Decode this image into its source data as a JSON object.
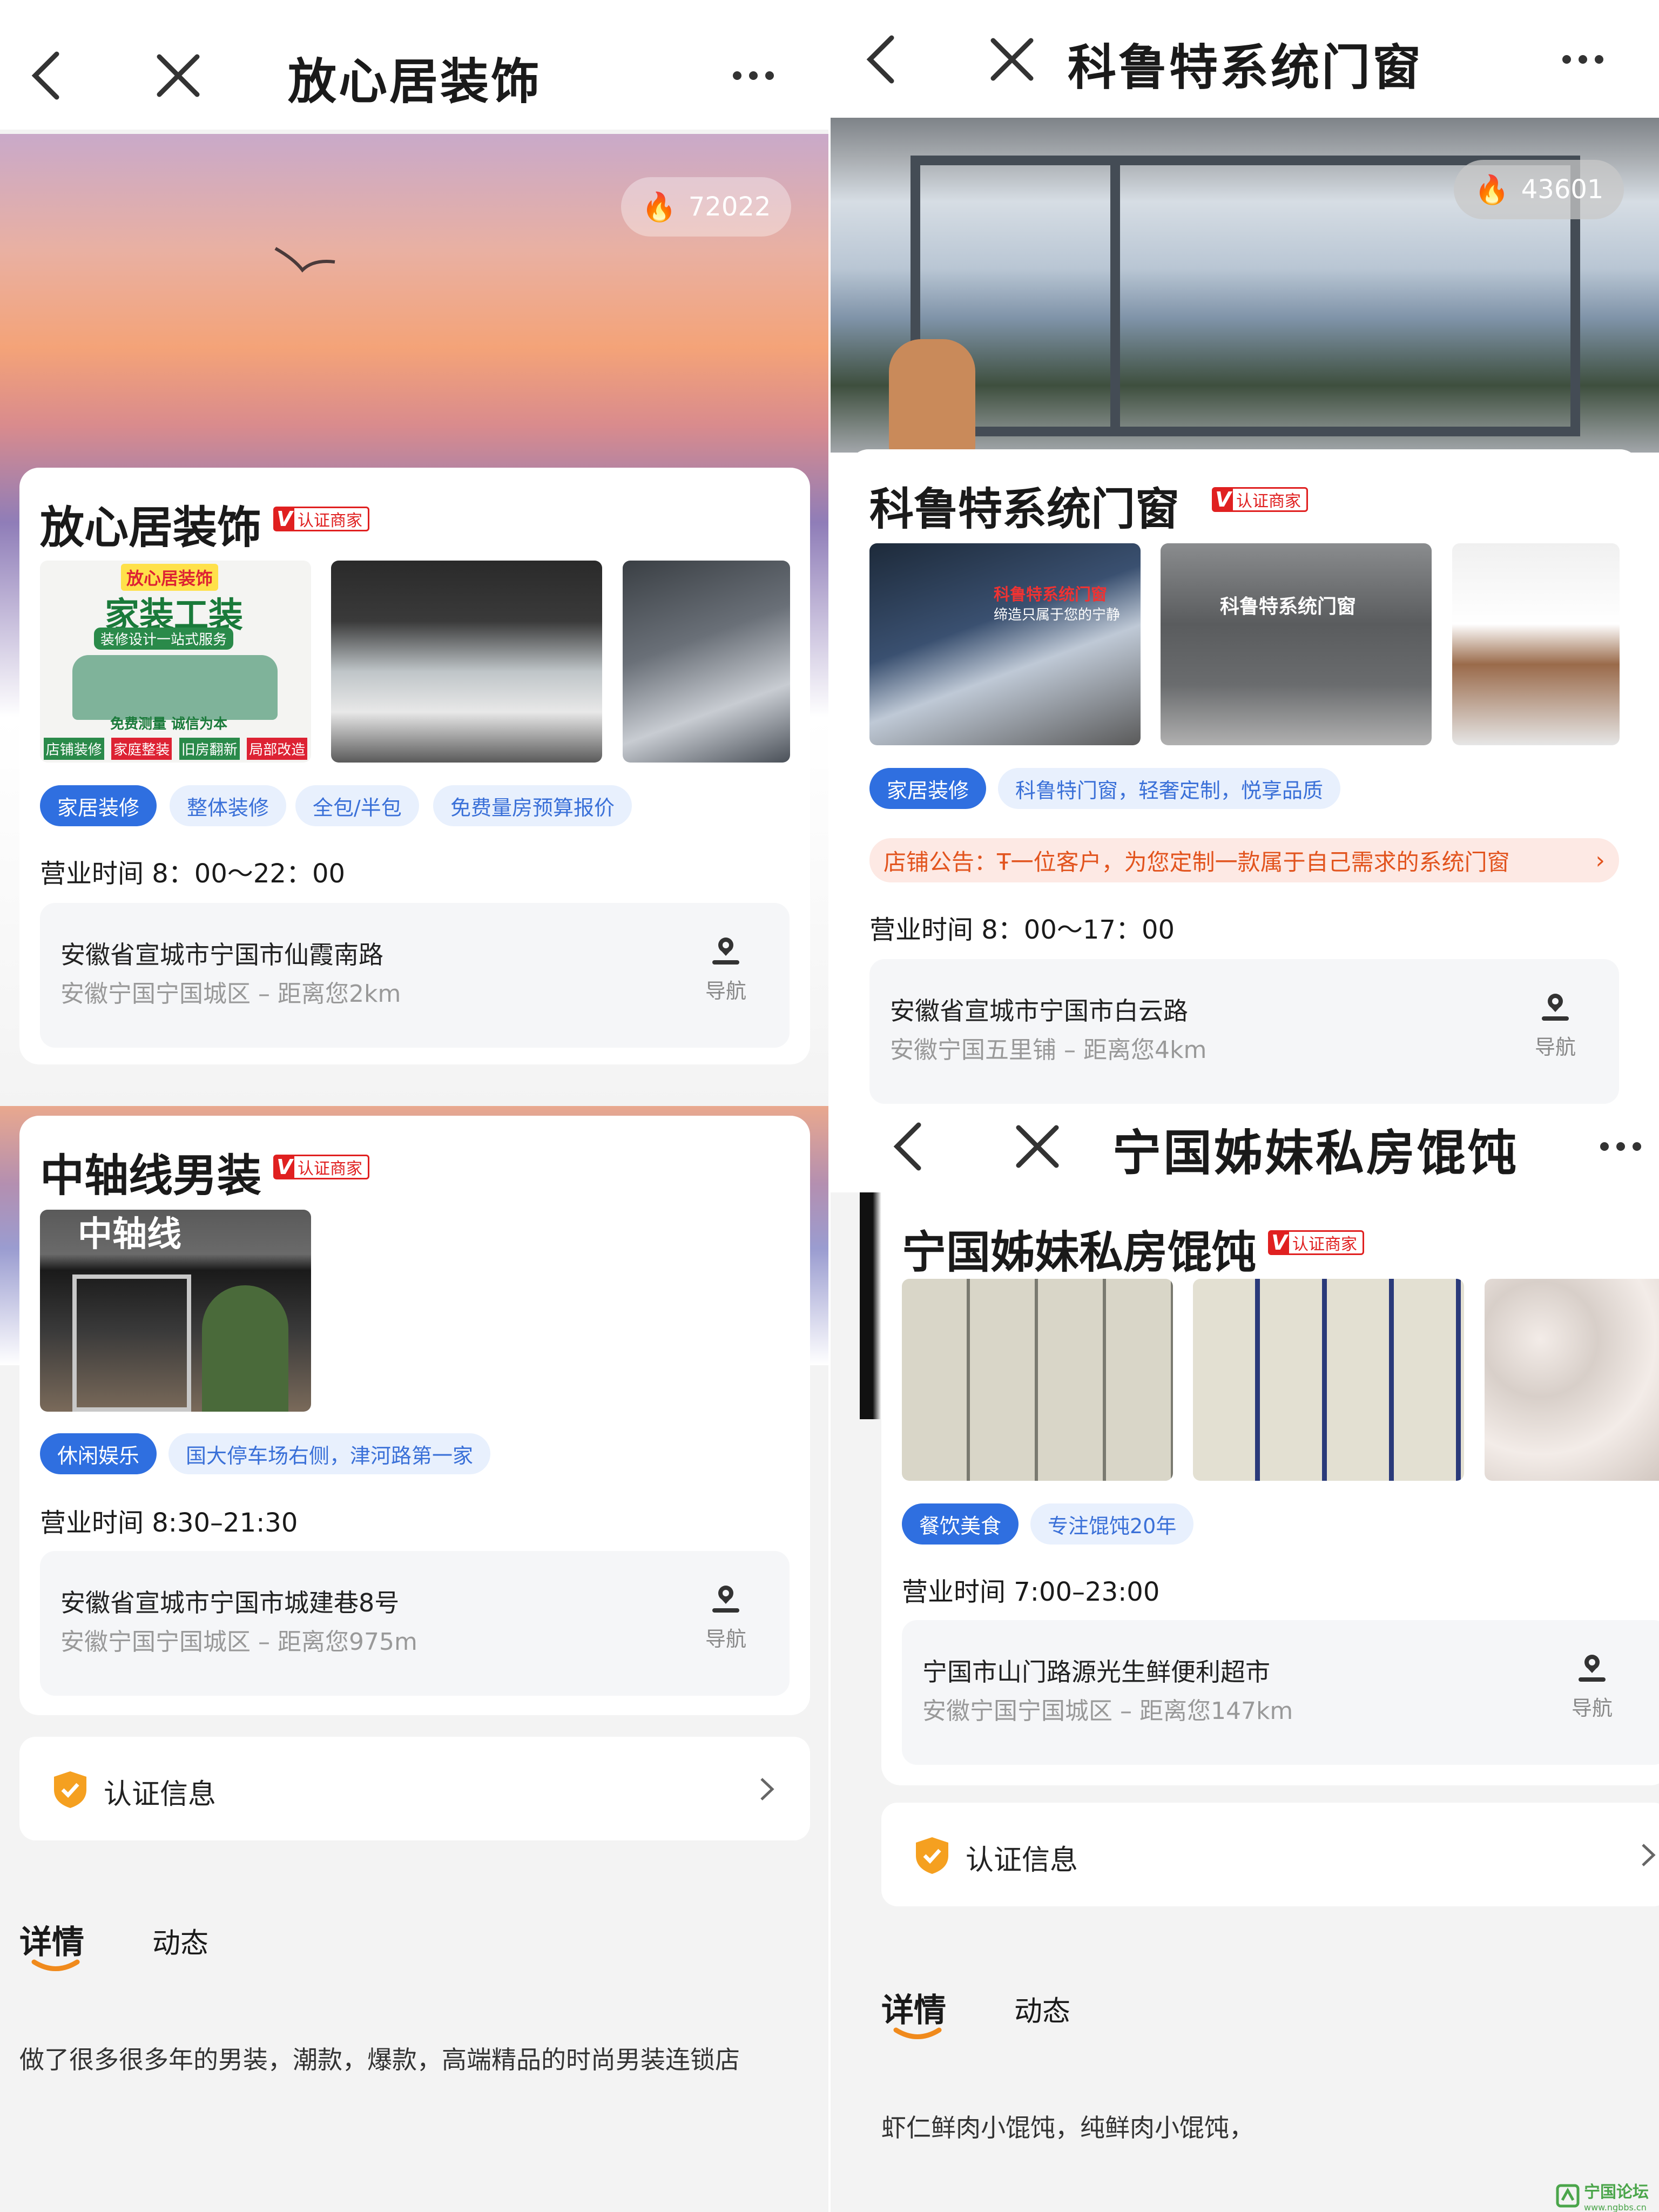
{
  "panel_tl": {
    "header_title": "放心居装饰",
    "hot_count": "72022",
    "shop_name": "放心居装饰",
    "badge": "认证商家",
    "ad_image": {
      "title": "放心居装饰",
      "headline": "家装工装",
      "sub": "装修设计一站式服务",
      "slogan": "免费测量 诚信为本",
      "bottom": [
        "店铺装修",
        "家庭整装",
        "旧房翻新",
        "局部改造"
      ]
    },
    "tags": [
      "家居装修",
      "整体装修",
      "全包/半包",
      "免费量房预算报价"
    ],
    "hours": "营业时间 8：00～22：00",
    "address_line1": "安徽省宣城市宁国市仙霞南路",
    "address_line2": "安徽宁国宁国城区 – 距离您2km",
    "nav_label": "导航"
  },
  "panel_tr": {
    "header_title": "科鲁特系统门窗",
    "hot_count": "43601",
    "shop_name": "科鲁特系统门窗",
    "badge": "认证商家",
    "thumb_texts": [
      "科鲁特系统门窗",
      "缔造只属于您的宁静",
      "科鲁特系统门窗"
    ],
    "tags": [
      "家居装修",
      "科鲁特门窗，轻奢定制，悦享品质"
    ],
    "notice": "店铺公告：Ŧ一位客户，为您定制一款属于自己需求的系统门窗",
    "hours": "营业时间 8：00～17：00",
    "address_line1": "安徽省宣城市宁国市白云路",
    "address_line2": "安徽宁国五里铺 – 距离您4km",
    "nav_label": "导航"
  },
  "panel_bl": {
    "shop_name": "中轴线男装",
    "badge": "认证商家",
    "storefront_text": "中轴线",
    "tags": [
      "休闲娱乐",
      "国大停车场右侧，津河路第一家"
    ],
    "hours": "营业时间 8:30–21:30",
    "address_line1": "安徽省宣城市宁国市城建巷8号",
    "address_line2": "安徽宁国宁国城区 – 距离您975m",
    "nav_label": "导航",
    "cert_label": "认证信息",
    "tab_details": "详情",
    "tab_dynamic": "动态",
    "description": "做了很多很多年的男装，潮款，爆款，高端精品的时尚男装连锁店"
  },
  "panel_br": {
    "header_title": "宁国姊妹私房馄饨",
    "shop_name": "宁国姊妹私房馄饨",
    "badge": "认证商家",
    "tags": [
      "餐饮美食",
      "专注馄饨20年"
    ],
    "hours": "营业时间 7:00–23:00",
    "address_line1": "宁国市山门路源光生鲜便利超市",
    "address_line2": "安徽宁国宁国城区 – 距离您147km",
    "nav_label": "导航",
    "cert_label": "认证信息",
    "tab_details": "详情",
    "tab_dynamic": "动态",
    "description": "虾仁鲜肉小馄饨，纯鲜肉小馄饨，"
  },
  "watermark": "宁国论坛",
  "watermark_url": "www.ngbbs.cn",
  "colors": {
    "primary_blue": "#2f6fe0",
    "tag_bg": "#e8f0fd",
    "badge_red": "#e02020",
    "notice_orange": "#e2541e",
    "tab_underline": "#f08a1c",
    "shield": "#f5a020"
  }
}
